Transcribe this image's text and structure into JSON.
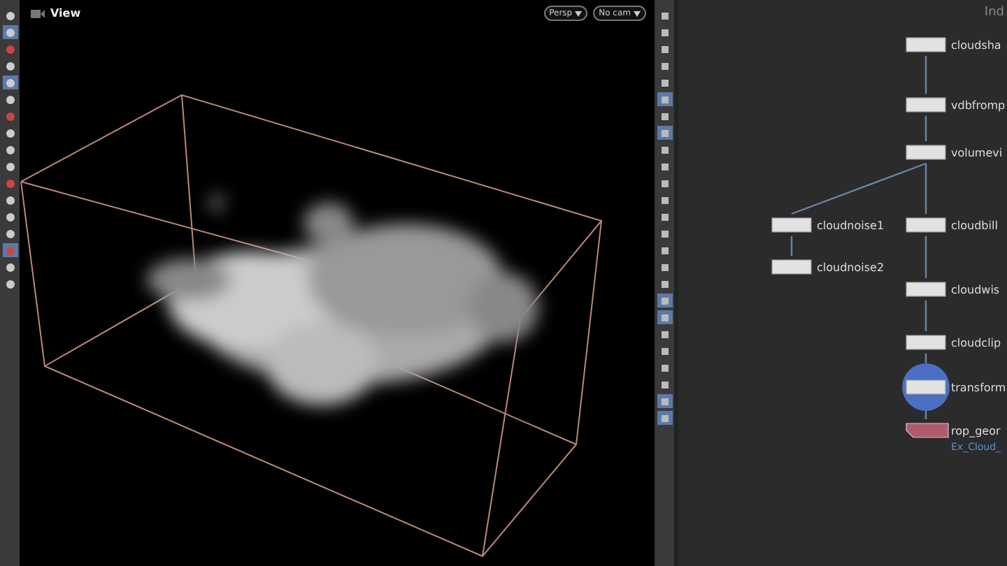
{
  "viewport": {
    "title": "View",
    "camera_buttons": [
      "Persp",
      "No cam"
    ]
  },
  "left_toolbar": [
    {
      "selected": false
    },
    {
      "selected": true
    },
    {
      "selected": false
    },
    {
      "selected": false
    },
    {
      "selected": true
    },
    {
      "selected": false
    },
    {
      "selected": false
    },
    {
      "selected": false
    },
    {
      "selected": false
    },
    {
      "selected": false
    },
    {
      "selected": false
    },
    {
      "selected": false
    },
    {
      "selected": false
    },
    {
      "selected": false
    },
    {
      "selected": true
    },
    {
      "selected": false
    },
    {
      "selected": false
    }
  ],
  "right_toolbar": [
    {
      "selected": false
    },
    {
      "selected": false
    },
    {
      "selected": false
    },
    {
      "selected": false
    },
    {
      "selected": false
    },
    {
      "selected": true
    },
    {
      "selected": false
    },
    {
      "selected": true
    },
    {
      "selected": false
    },
    {
      "selected": false
    },
    {
      "selected": false
    },
    {
      "selected": false
    },
    {
      "selected": false
    },
    {
      "selected": false
    },
    {
      "selected": false
    },
    {
      "selected": false
    },
    {
      "selected": false
    },
    {
      "selected": true
    },
    {
      "selected": true
    },
    {
      "selected": false
    },
    {
      "selected": false
    },
    {
      "selected": false
    },
    {
      "selected": false
    },
    {
      "selected": true
    },
    {
      "selected": true
    }
  ],
  "network": {
    "corner_label": "Ind",
    "nodes": [
      {
        "name": "cloudsha",
        "kind": "sop",
        "display": false
      },
      {
        "name": "vdbfromp",
        "kind": "sop",
        "display": false
      },
      {
        "name": "volumevi",
        "kind": "sop",
        "display": false
      },
      {
        "name": "cloudnoise1",
        "kind": "sop",
        "display": false
      },
      {
        "name": "cloudbill",
        "kind": "sop",
        "display": false
      },
      {
        "name": "cloudnoise2",
        "kind": "sop",
        "display": false
      },
      {
        "name": "cloudwis",
        "kind": "sop",
        "display": false
      },
      {
        "name": "cloudclip",
        "kind": "sop",
        "display": false
      },
      {
        "name": "transform",
        "kind": "sop",
        "display": true
      },
      {
        "name": "rop_geor",
        "kind": "rop",
        "display": false,
        "sublabel": "Ex_Cloud_"
      }
    ]
  }
}
